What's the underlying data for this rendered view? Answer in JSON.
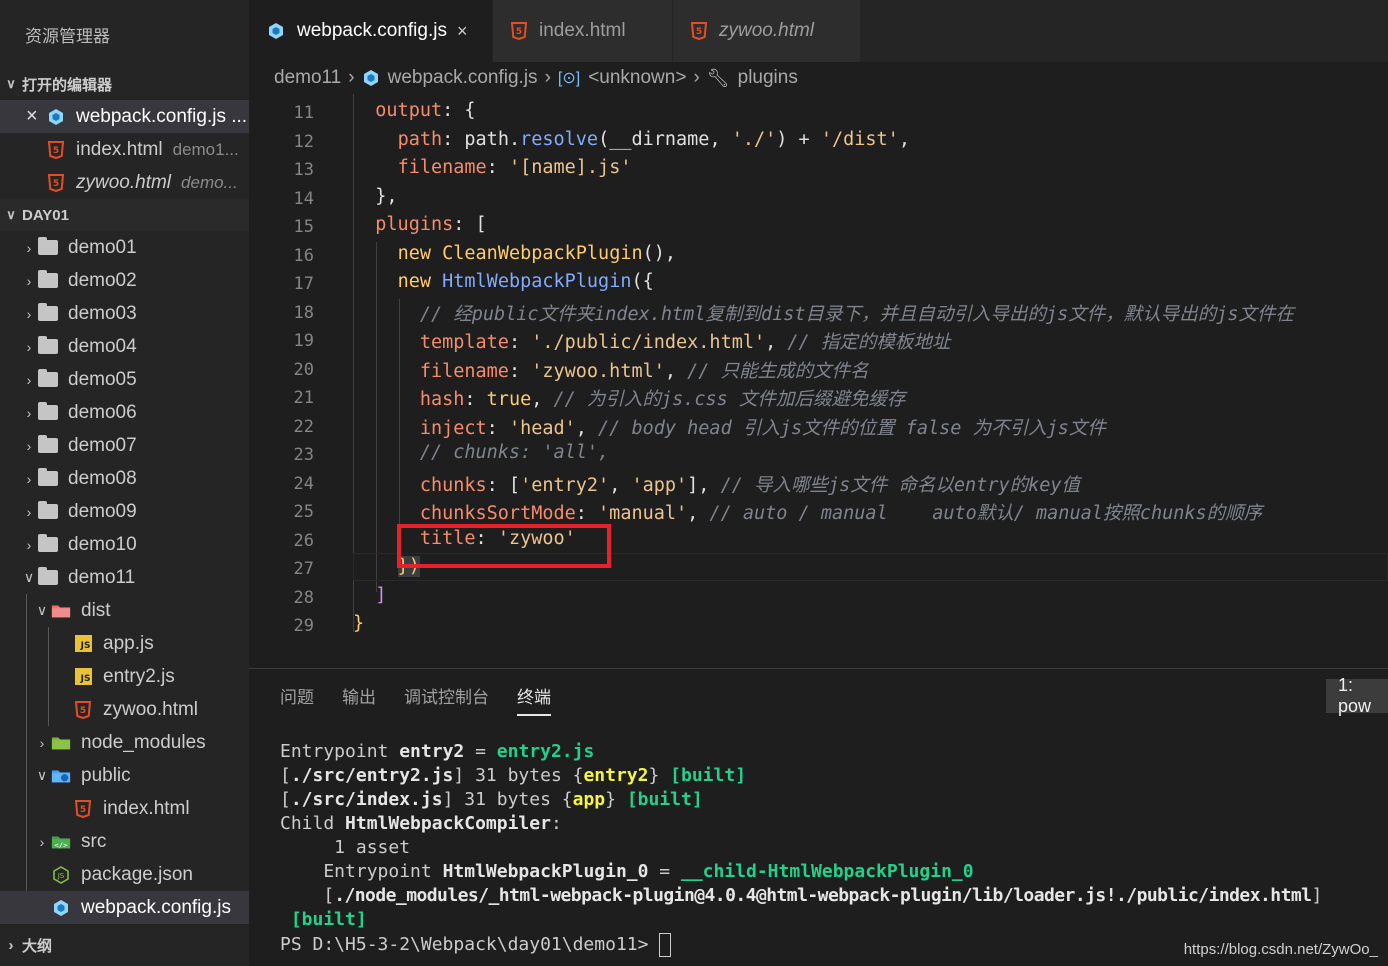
{
  "explorer": {
    "title": "资源管理器",
    "open_editors": {
      "label": "打开的编辑器",
      "items": [
        {
          "name": "webpack.config.js ...",
          "desc": ""
        },
        {
          "name": "index.html",
          "desc": "demo1..."
        },
        {
          "name": "zywoo.html",
          "desc": "demo..."
        }
      ]
    },
    "workspace": {
      "label": "DAY01",
      "folders": [
        "demo01",
        "demo02",
        "demo03",
        "demo04",
        "demo05",
        "demo06",
        "demo07",
        "demo08",
        "demo09",
        "demo10",
        "demo11"
      ],
      "demo11_children": {
        "dist": "dist",
        "dist_files": [
          "app.js",
          "entry2.js",
          "zywoo.html"
        ],
        "node_modules": "node_modules",
        "public": "public",
        "public_files": [
          "index.html"
        ],
        "src": "src",
        "package_json": "package.json",
        "webpack_config": "webpack.config.js"
      }
    },
    "outline_label": "大纲"
  },
  "tabs": [
    {
      "label": "webpack.config.js",
      "close": "×"
    },
    {
      "label": "index.html"
    },
    {
      "label": "zywoo.html"
    }
  ],
  "breadcrumb": [
    "demo11",
    "webpack.config.js",
    "<unknown>",
    "plugins"
  ],
  "code": {
    "line_numbers": [
      "11",
      "12",
      "13",
      "14",
      "15",
      "16",
      "17",
      "18",
      "19",
      "20",
      "21",
      "22",
      "23",
      "24",
      "25",
      "26",
      "27",
      "28",
      "29"
    ],
    "lines": {
      "l11a": "output",
      "l11b": ": {",
      "l12a": "path",
      "l12b": ": path.",
      "l12c": "resolve",
      "l12d": "(__dirname, ",
      "l12e": "'./'",
      "l12f": ") + ",
      "l12g": "'/dist'",
      "l12h": ",",
      "l13a": "filename",
      "l13b": ": ",
      "l13c": "'[name].js'",
      "l14": "},",
      "l15a": "plugins",
      "l15b": ": [",
      "l16a": "new ",
      "l16b": "CleanWebpackPlugin",
      "l16c": "(),",
      "l17a": "new ",
      "l17b": "HtmlWebpackPlugin",
      "l17c": "({",
      "l18": "// 经public文件夹index.html复制到dist目录下，并且自动引入导出的js文件，默认导出的js文件在",
      "l19a": "template",
      "l19b": ": ",
      "l19c": "'./public/index.html'",
      "l19d": ", ",
      "l19e": "// 指定的模板地址",
      "l20a": "filename",
      "l20b": ": ",
      "l20c": "'zywoo.html'",
      "l20d": ", ",
      "l20e": "// 只能生成的文件名",
      "l21a": "hash",
      "l21b": ": ",
      "l21c": "true",
      "l21d": ", ",
      "l21e": "// 为引入的js.css 文件加后缀避免缓存",
      "l22a": "inject",
      "l22b": ": ",
      "l22c": "'head'",
      "l22d": ", ",
      "l22e": "// body head 引入js文件的位置 false 为不引入js文件",
      "l23": "// chunks: 'all',",
      "l24a": "chunks",
      "l24b": ": [",
      "l24c": "'entry2'",
      "l24d": ", ",
      "l24e": "'app'",
      "l24f": "], ",
      "l24g": "// 导入哪些js文件 命名以entry的key值",
      "l25a": "chunksSortMode",
      "l25b": ": ",
      "l25c": "'manual'",
      "l25d": ", ",
      "l25e": "// auto / manual    auto默认/ manual按照chunks的顺序",
      "l26a": "title",
      "l26b": ": ",
      "l26c": "'zywoo'",
      "l27": "})",
      "l28": "]",
      "l29": "}"
    }
  },
  "panel": {
    "tabs": [
      "问题",
      "输出",
      "调试控制台",
      "终端"
    ],
    "terminal_selector": "1: pow",
    "terminal": {
      "t1a": "Entrypoint ",
      "t1b": "entry2",
      "t1c": " = ",
      "t1d": "entry2.js",
      "t2a": "[",
      "t2b": "./src/entry2.js",
      "t2c": "] 31 bytes {",
      "t2d": "entry2",
      "t2e": "} ",
      "t2f": "[built]",
      "t3a": "[",
      "t3b": "./src/index.js",
      "t3c": "] 31 bytes {",
      "t3d": "app",
      "t3e": "} ",
      "t3f": "[built]",
      "t4a": "Child ",
      "t4b": "HtmlWebpackCompiler",
      "t4c": ":",
      "t5": "     1 asset",
      "t6a": "    Entrypoint ",
      "t6b": "HtmlWebpackPlugin_0",
      "t6c": " = ",
      "t6d": "__child-HtmlWebpackPlugin_0",
      "t7a": "    [",
      "t7b": "./node_modules/_html-webpack-plugin@4.0.4@html-webpack-plugin/lib/loader.js!./public/index.html",
      "t7c": "]",
      "t8": " [built]",
      "t9": "PS D:\\H5-3-2\\Webpack\\day01\\demo11> "
    }
  },
  "watermark": "https://blog.csdn.net/ZywOo_",
  "colors": {
    "accent_highlight_box": "#e5212b",
    "html_icon": "#e44d26",
    "js_icon": "#e8c33a"
  }
}
